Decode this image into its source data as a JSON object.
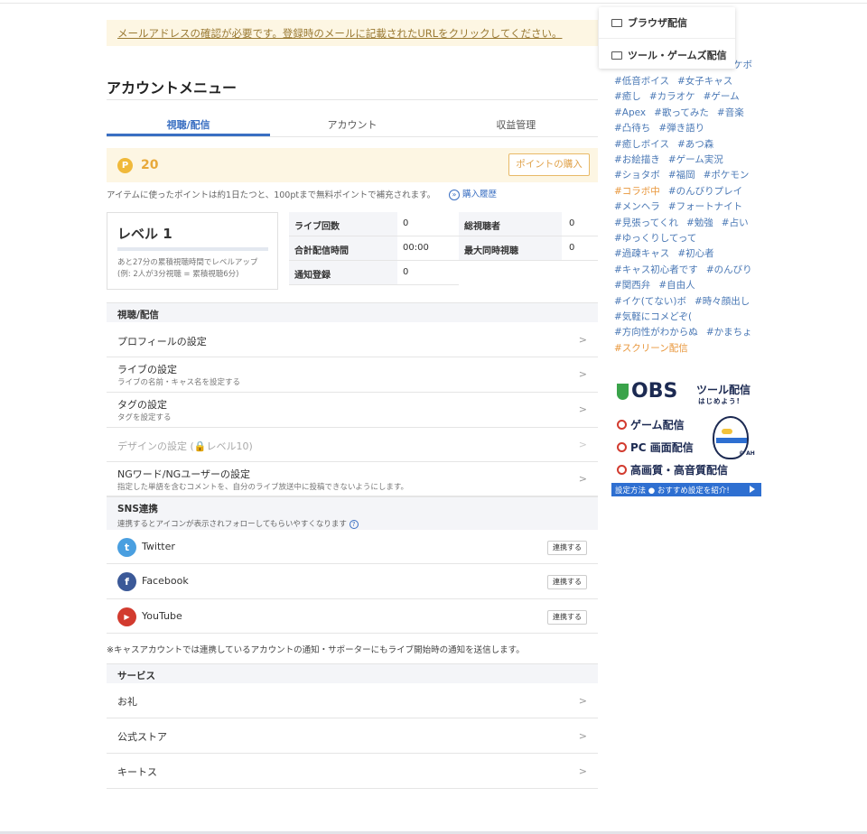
{
  "notice": "メールアドレスの確認が必要です。登録時のメールに記載されたURLをクリックしてください。",
  "page_title": "アカウントメニュー",
  "tabs": [
    "視聴/配信",
    "アカウント",
    "収益管理"
  ],
  "points": {
    "coin": "P",
    "value": "20",
    "buy_label": "ポイントの購入",
    "note": "アイテムに使ったポイントは約1日たつと、100ptまで無料ポイントで補充されます。",
    "history_label": "購入履歴"
  },
  "level": {
    "title": "レベル 1",
    "progress": 0,
    "note_line1": "あと27分の累積視聴時間でレベルアップ",
    "note_line2": "(例: 2人が3分視聴 = 累積視聴6分)"
  },
  "stats": [
    {
      "label": "ライブ回数",
      "value": "0"
    },
    {
      "label": "総視聴者",
      "value": "0"
    },
    {
      "label": "合計配信時間",
      "value": "00:00"
    },
    {
      "label": "最大同時視聴",
      "value": "0"
    },
    {
      "label": "通知登録",
      "value": "0"
    }
  ],
  "section_view": {
    "heading": "視聴/配信",
    "items": [
      {
        "label": "プロフィールの設定",
        "sub": "",
        "chevron": ">"
      },
      {
        "label": "ライブの設定",
        "sub": "ライブの名前・キャス名を設定する",
        "chevron": ">"
      },
      {
        "label": "タグの設定",
        "sub": "タグを設定する",
        "chevron": ">"
      },
      {
        "label": "デザインの設定 (🔒レベル10)",
        "sub": "",
        "chevron": ">"
      },
      {
        "label": "NGワード/NGユーザーの設定",
        "sub": "指定した単語を含むコメントを、自分のライブ放送中に投稿できないようにします。",
        "chevron": ">"
      }
    ]
  },
  "sns": {
    "heading": "SNS連携",
    "sub": "連携するとアイコンが表示されフォローしてもらいやすくなります",
    "help": "?",
    "items": [
      {
        "name": "Twitter",
        "button": "連携する",
        "color": "#4a9fe0",
        "icon": "t"
      },
      {
        "name": "Facebook",
        "button": "連携する",
        "color": "#3b5998",
        "icon": "f"
      },
      {
        "name": "YouTube",
        "button": "連携する",
        "color": "#d23b2f",
        "icon": "▶"
      }
    ],
    "note": "※キャスアカウントでは連携しているアカウントの通知・サポーターにもライブ開始時の通知を送信します。"
  },
  "section_service": {
    "heading": "サービス",
    "items": [
      {
        "label": "お礼",
        "chevron": ">"
      },
      {
        "label": "公式ストア",
        "chevron": ">"
      },
      {
        "label": "キートス",
        "chevron": ">"
      }
    ]
  },
  "dropdown": {
    "item1": "ブラウザ配信",
    "item2": "ツール・ゲームズ配信"
  },
  "tags": {
    "top_partial": "ケボ",
    "lines": [
      [
        {
          "t": "#低音ボイス"
        },
        {
          "t": "#女子キャス"
        }
      ],
      [
        {
          "t": "#癒し"
        },
        {
          "t": "#カラオケ"
        },
        {
          "t": "#ゲーム"
        }
      ],
      [
        {
          "t": "#Apex"
        },
        {
          "t": "#歌ってみた"
        },
        {
          "t": "#音楽"
        }
      ],
      [
        {
          "t": "#凸待ち"
        },
        {
          "t": "#弾き語り"
        }
      ],
      [
        {
          "t": "#癒しボイス"
        },
        {
          "t": "#あつ森"
        }
      ],
      [
        {
          "t": "#お絵描き"
        },
        {
          "t": "#ゲーム実況"
        }
      ],
      [
        {
          "t": "#ショタボ"
        },
        {
          "t": "#福岡"
        },
        {
          "t": "#ポケモン"
        }
      ],
      [
        {
          "t": "#コラボ中",
          "o": true
        },
        {
          "t": "#のんびりプレイ"
        }
      ],
      [
        {
          "t": "#メンヘラ"
        },
        {
          "t": "#フォートナイト"
        }
      ],
      [
        {
          "t": "#見張ってくれ"
        },
        {
          "t": "#勉強"
        },
        {
          "t": "#占い"
        }
      ],
      [
        {
          "t": "#ゆっくりしてって"
        }
      ],
      [
        {
          "t": "#過疎キャス"
        },
        {
          "t": "#初心者"
        }
      ],
      [
        {
          "t": "#キャス初心者です"
        },
        {
          "t": "#のんびり"
        }
      ],
      [
        {
          "t": "#関西弁"
        },
        {
          "t": "#自由人"
        }
      ],
      [
        {
          "t": "#イケ(てない)ボ"
        },
        {
          "t": "#時々顔出し"
        }
      ],
      [
        {
          "t": "#気軽にコメどぞ("
        }
      ],
      [
        {
          "t": "#方向性がわからぬ"
        },
        {
          "t": "#かまちょ"
        }
      ],
      [
        {
          "t": "#スクリーン配信",
          "o": true
        }
      ]
    ]
  },
  "obs_banner": {
    "logo": "OBS",
    "title": "ツール配信",
    "subtitle": "はじめよう!",
    "row1": "ゲーム配信",
    "row2": "PC 画面配信",
    "row3": "高画質・高音質配信",
    "credit": "© AH",
    "cta": "設定方法 ● おすすめ設定を紹介!"
  }
}
